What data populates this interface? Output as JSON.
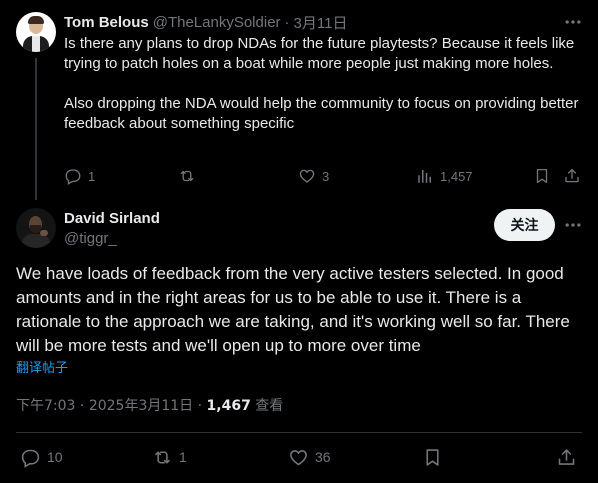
{
  "reply_tweet": {
    "name": "Tom Belous",
    "handle": "@TheLankySoldier",
    "separator": "·",
    "date": "3月11日",
    "more_icon": "more-horizontal-icon",
    "text_p1": "Is there any plans to drop NDAs for the future playtests? Because it feels like trying to patch holes on a boat while more people just making more holes.",
    "text_p2": "Also dropping the NDA would help the community to focus on providing better feedback about something specific",
    "actions": {
      "replies": "1",
      "reposts": "",
      "likes": "3",
      "views": "1,457"
    }
  },
  "main_tweet": {
    "name": "David Sirland",
    "handle": "@tiggr_",
    "follow_label": "关注",
    "text": "We have loads of feedback from the very active testers selected. In good amounts and in the right areas for us to be able to use it. There is a rationale to the approach we are taking, and it's working well so far. There will be more tests and we'll open up to more over time",
    "translate_label": "翻译帖子",
    "time": "下午7:03",
    "separator": "·",
    "date": "2025年3月11日",
    "views_count": "1,467",
    "views_label": "查看",
    "actions": {
      "replies": "10",
      "reposts": "1",
      "likes": "36"
    }
  },
  "colors": {
    "background": "#000000",
    "text_primary": "#e7e9ea",
    "text_secondary": "#71767b",
    "link": "#1d9bf0",
    "button_bg": "#eff3f4"
  }
}
